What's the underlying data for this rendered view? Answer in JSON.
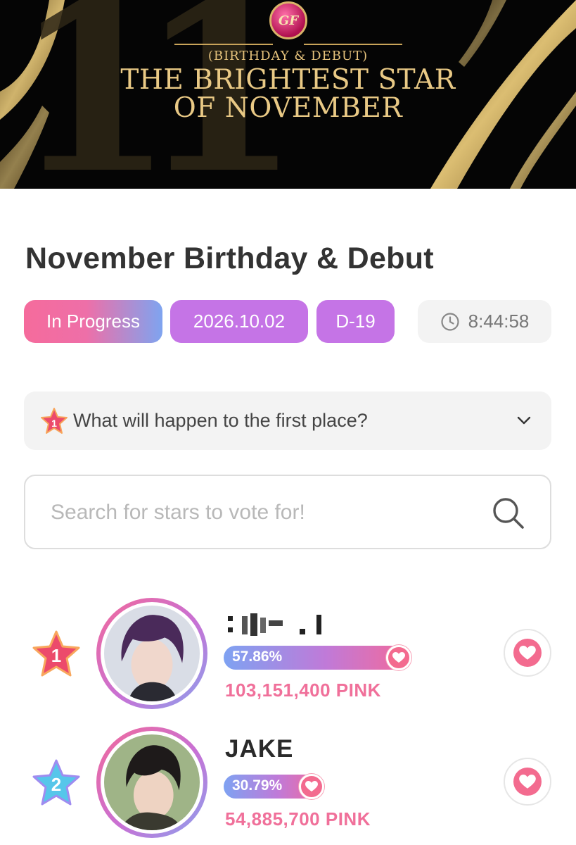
{
  "banner": {
    "subtitle": "(BIRTHDAY & DEBUT)",
    "title_line1": "THE BRIGHTEST STAR",
    "title_line2": "OF NOVEMBER",
    "big_number": "11",
    "logo_text": "GF",
    "colors": {
      "background": "#050505",
      "gold": "#e9c985",
      "logo": "#b0104f"
    }
  },
  "event": {
    "title": "November Birthday & Debut",
    "status": "In Progress",
    "date": "2026.10.02",
    "dday": "D-19",
    "countdown": "8:44:58",
    "first_place_question": "What will happen to the first place?"
  },
  "search": {
    "placeholder": "Search for stars to vote for!",
    "value": ""
  },
  "ranking": [
    {
      "rank": "1",
      "name": "",
      "name_redacted": true,
      "percent_label": "57.86%",
      "share": 0.5786,
      "pink_total": "103,151,400 PINK",
      "badge_color": "#ec4a6b"
    },
    {
      "rank": "2",
      "name": "JAKE",
      "name_redacted": false,
      "percent_label": "30.79%",
      "share": 0.3079,
      "pink_total": "54,885,700 PINK",
      "badge_color": "#52c8e8"
    }
  ],
  "colors": {
    "accent_pink": "#f0709a",
    "accent_purple": "#c574e6",
    "accent_blue": "#7ea4f0",
    "heart": "#f36b8f"
  }
}
